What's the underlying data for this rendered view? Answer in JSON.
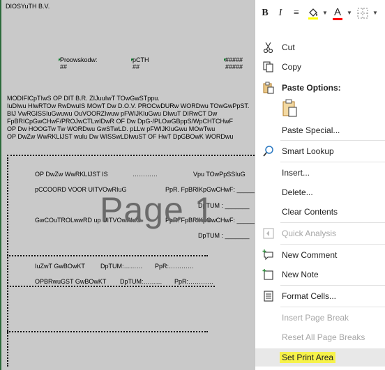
{
  "sheet": {
    "company_partial": "DIOSYuTH B.V.",
    "header_fields": [
      {
        "label": "Proowskodw:",
        "value": "##"
      },
      {
        "label": "pCTH",
        "value": "##"
      },
      {
        "label": "#####",
        "value": "#####"
      }
    ],
    "paragraph_lines": [
      "MODIFICpTIwS OP DIT B.R. ZIJuuIwT TOwGwSTppu.",
      "IuDlwu HlwRTOw RwDwuIS MOwT Dw D.O.V. PROCwDURw WORDwu TOwGwPpST.",
      "BIJ VwRGISSIuGwuwu OuVOORZIwuw pFWIJKIuGwu DIwuT DIRwCT Dw",
      "FpBRICpGwCHwF/PROJwCTLwIDwR OF Dw DpG-/PLOwGBppS/WpCHTCHwF",
      "OP Dw HOOGTw Tw WORDwu GwSTwLD. pLLw pFWIJKIuGwu MOwTwu",
      "OP DwZw WwRKLIJST wuIu Dw WISSwLDIwuST OF HwT DpGBOwK WORDwu"
    ],
    "form_rows": [
      {
        "left": "OP DwZw WwRKLIJST IS",
        "mid": "…………",
        "right": "Vpu TOwPpSSIuG"
      },
      {
        "left": "pCCOORD VOOR UITVOwRIuG",
        "right": "PpR. FpBRIKpGwCHwF: _______"
      },
      {
        "right": "DpTUM : _______"
      },
      {
        "left": "GwCOuTROLwwRD up UITVOwRIuG",
        "right": "PpR. FpBRIKpGwCHwF: _______"
      },
      {
        "right": "DpTUM : _______"
      }
    ],
    "sign_rows": [
      {
        "a": "IuZwT GwBOwKT",
        "b": "DpTUM:………",
        "c": "PpR:…………"
      },
      {
        "a": "OPBRwuGST GwBOwKT",
        "b": "DpTUM:………",
        "c": "PpR:…………"
      }
    ],
    "watermark": "Page 1"
  },
  "mini_toolbar": {
    "bold": "B",
    "italic": "I",
    "align": "≡",
    "fill_color": "#ffff00",
    "font_color": "#ff0000",
    "font_color_letter": "A"
  },
  "context_menu": {
    "items": [
      {
        "label": "Cut",
        "icon": "scissors-icon",
        "enabled": true
      },
      {
        "label": "Copy",
        "icon": "copy-icon",
        "enabled": true
      },
      {
        "label": "Paste Options:",
        "icon": "paste-icon",
        "enabled": true,
        "header": true
      },
      {
        "label": "Paste Special...",
        "icon": "",
        "enabled": true
      },
      {
        "label": "Smart Lookup",
        "icon": "smart-lookup-icon",
        "enabled": true
      },
      {
        "label": "Insert...",
        "icon": "",
        "enabled": true
      },
      {
        "label": "Delete...",
        "icon": "",
        "enabled": true
      },
      {
        "label": "Clear Contents",
        "icon": "",
        "enabled": true
      },
      {
        "label": "Quick Analysis",
        "icon": "quick-analysis-icon",
        "enabled": false
      },
      {
        "label": "New Comment",
        "icon": "new-comment-icon",
        "enabled": true
      },
      {
        "label": "New Note",
        "icon": "new-note-icon",
        "enabled": true
      },
      {
        "label": "Format Cells...",
        "icon": "format-cells-icon",
        "enabled": true
      },
      {
        "label": "Insert Page Break",
        "icon": "",
        "enabled": false
      },
      {
        "label": "Reset All Page Breaks",
        "icon": "",
        "enabled": false
      },
      {
        "label": "Set Print Area",
        "icon": "",
        "enabled": true,
        "highlighted": true
      }
    ],
    "highlight_color": "#f6f24a"
  }
}
